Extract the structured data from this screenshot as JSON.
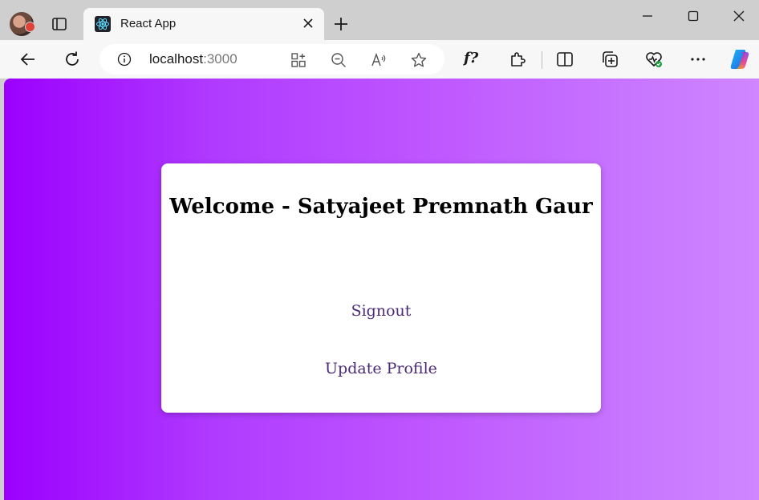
{
  "browser": {
    "tab_title": "React App",
    "address": {
      "host": "localhost",
      "port": ":3000"
    },
    "toolbar_font_button": "f?"
  },
  "page": {
    "welcome_heading": "Welcome - Satyajeet Premnath Gaur",
    "links": {
      "signout": "Signout",
      "update_profile": "Update Profile"
    }
  },
  "colors": {
    "gradient_start": "#9b00ff",
    "gradient_end": "#cf86ff",
    "link": "#4b2a78"
  }
}
